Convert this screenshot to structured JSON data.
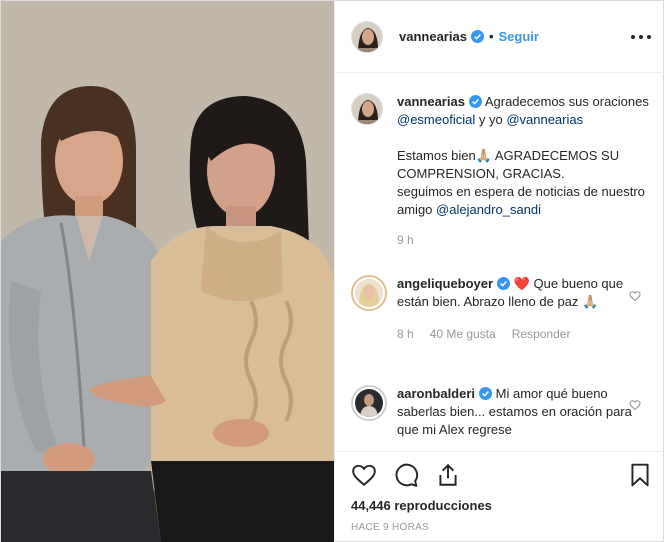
{
  "header": {
    "username": "vannearias",
    "separator": "•",
    "follow_label": "Seguir"
  },
  "caption": {
    "username": "vannearias",
    "line1": "Agradecemos sus oraciones ",
    "mention1": "@esmeoficial",
    "line2": " y yo ",
    "mention2": "@vannearias",
    "paragraph2": "Estamos bien🙏🏼 AGRADECEMOS SU COMPRENSION, GRACIAS.",
    "paragraph3": "seguimos en espera de noticias de nuestro amigo ",
    "mention3": "@alejandro_sandi",
    "time": "9 h"
  },
  "comments": [
    {
      "username": "angeliqueboyer",
      "text": " ❤️ Que bueno que están bien. Abrazo lleno de paz 🙏🏼",
      "time": "8 h",
      "likes": "40 Me gusta",
      "reply_label": "Responder"
    },
    {
      "username": "aaronbalderi",
      "text": " Mi amor qué bueno saberlas bien... estamos en oración para que mi Alex regrese"
    }
  ],
  "stats": {
    "views": "44,446 reproducciones",
    "posted": "HACE 9 HORAS"
  },
  "icons": {
    "like": "heart-icon",
    "comment": "comment-icon",
    "share": "share-icon",
    "save": "bookmark-icon",
    "verified": "verified-badge-icon",
    "options": "more-options-icon"
  },
  "colors": {
    "accent": "#3897f0",
    "mention": "#003569",
    "muted": "#999999",
    "heart": "#ed4956"
  }
}
